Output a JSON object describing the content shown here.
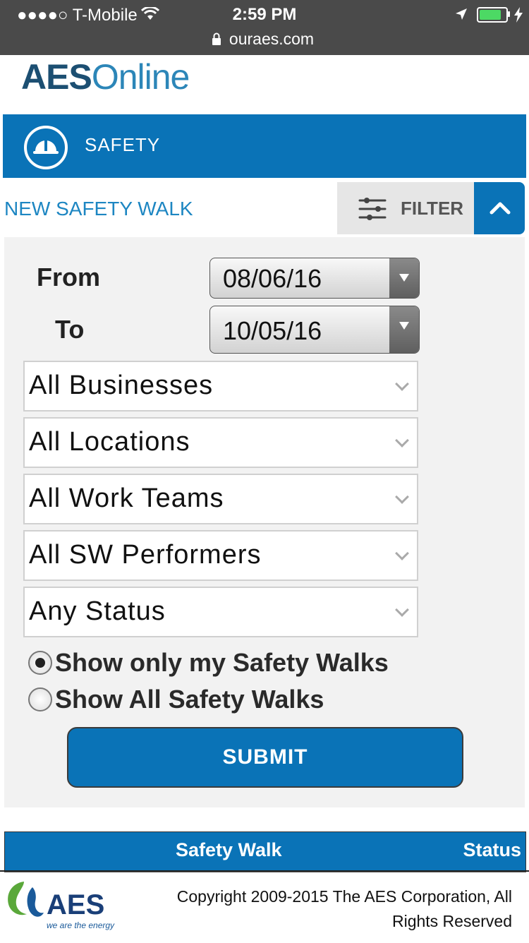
{
  "status_bar": {
    "carrier": "●●●●○ T-Mobile",
    "time": "2:59 PM",
    "url": "ouraes.com"
  },
  "brand": {
    "logo_text_bold": "AES",
    "logo_text_light": "Online"
  },
  "banner": {
    "title": "SAFETY",
    "color": "#0a73b7"
  },
  "toolbar": {
    "new_walk_label": "NEW SAFETY WALK",
    "filter_label": "FILTER"
  },
  "filters": {
    "from_label": "From",
    "to_label": "To",
    "from_value": "08/06/16",
    "to_value": "10/05/16",
    "business": "All Businesses",
    "location": "All Locations",
    "work_team": "All Work Teams",
    "performer": "All SW Performers",
    "status": "Any Status",
    "radio_mine": "Show only my Safety Walks",
    "radio_all": "Show All Safety Walks",
    "radio_selected": "mine",
    "submit_label": "SUBMIT"
  },
  "table": {
    "columns": [
      "Safety Walk",
      "Status"
    ]
  },
  "footer": {
    "copyright": "Copyright 2009-2015 The AES Corporation, All Rights Reserved",
    "logo_name": "AES",
    "logo_tagline": "we are the energy"
  }
}
